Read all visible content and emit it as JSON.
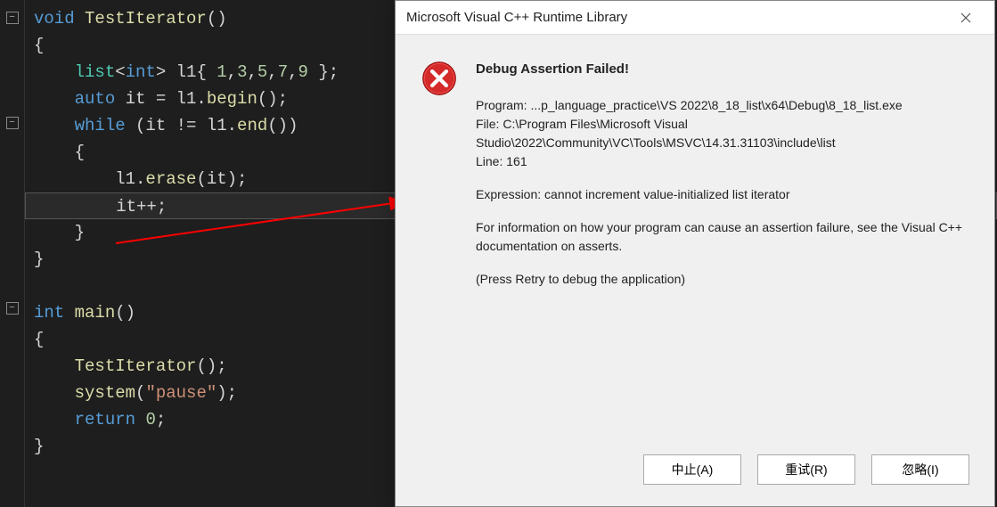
{
  "code": {
    "line1": {
      "t1": "void",
      "t2": " ",
      "t3": "TestIterator",
      "t4": "()"
    },
    "line2": "{",
    "line3": {
      "t1": "    ",
      "t2": "list",
      "t3": "<",
      "t4": "int",
      "t5": "> l1{ ",
      "t6": "1",
      "t7": ",",
      "t8": "3",
      "t9": ",",
      "t10": "5",
      "t11": ",",
      "t12": "7",
      "t13": ",",
      "t14": "9",
      "t15": " };"
    },
    "line4": {
      "t1": "    ",
      "t2": "auto",
      "t3": " it = l1.",
      "t4": "begin",
      "t5": "();"
    },
    "line5": {
      "t1": "    ",
      "t2": "while",
      "t3": " (it != l1.",
      "t4": "end",
      "t5": "())"
    },
    "line6": "    {",
    "line7": {
      "t1": "        l1.",
      "t2": "erase",
      "t3": "(it);"
    },
    "line8": "        it++;",
    "line9": "    }",
    "line10": "}",
    "line11": "",
    "line12": {
      "t1": "int",
      "t2": " ",
      "t3": "main",
      "t4": "()"
    },
    "line13": "{",
    "line14": {
      "t1": "    ",
      "t2": "TestIterator",
      "t3": "();"
    },
    "line15": {
      "t1": "    ",
      "t2": "system",
      "t3": "(",
      "t4": "\"pause\"",
      "t5": ");"
    },
    "line16": {
      "t1": "    ",
      "t2": "return",
      "t3": " ",
      "t4": "0",
      "t5": ";"
    },
    "line17": "}"
  },
  "dialog": {
    "title": "Microsoft Visual C++ Runtime Library",
    "heading": "Debug Assertion Failed!",
    "program_label": "Program: ...p_language_practice\\VS 2022\\8_18_list\\x64\\Debug\\8_18_list.exe",
    "file_label": "File: C:\\Program Files\\Microsoft Visual Studio\\2022\\Community\\VC\\Tools\\MSVC\\14.31.31103\\include\\list",
    "line_label": "Line: 161",
    "expression": "Expression: cannot increment value-initialized list iterator",
    "info": "For information on how your program can cause an assertion failure, see the Visual C++ documentation on asserts.",
    "retry_hint": "(Press Retry to debug the application)",
    "buttons": {
      "abort": "中止(A)",
      "retry": "重试(R)",
      "ignore": "忽略(I)"
    }
  }
}
